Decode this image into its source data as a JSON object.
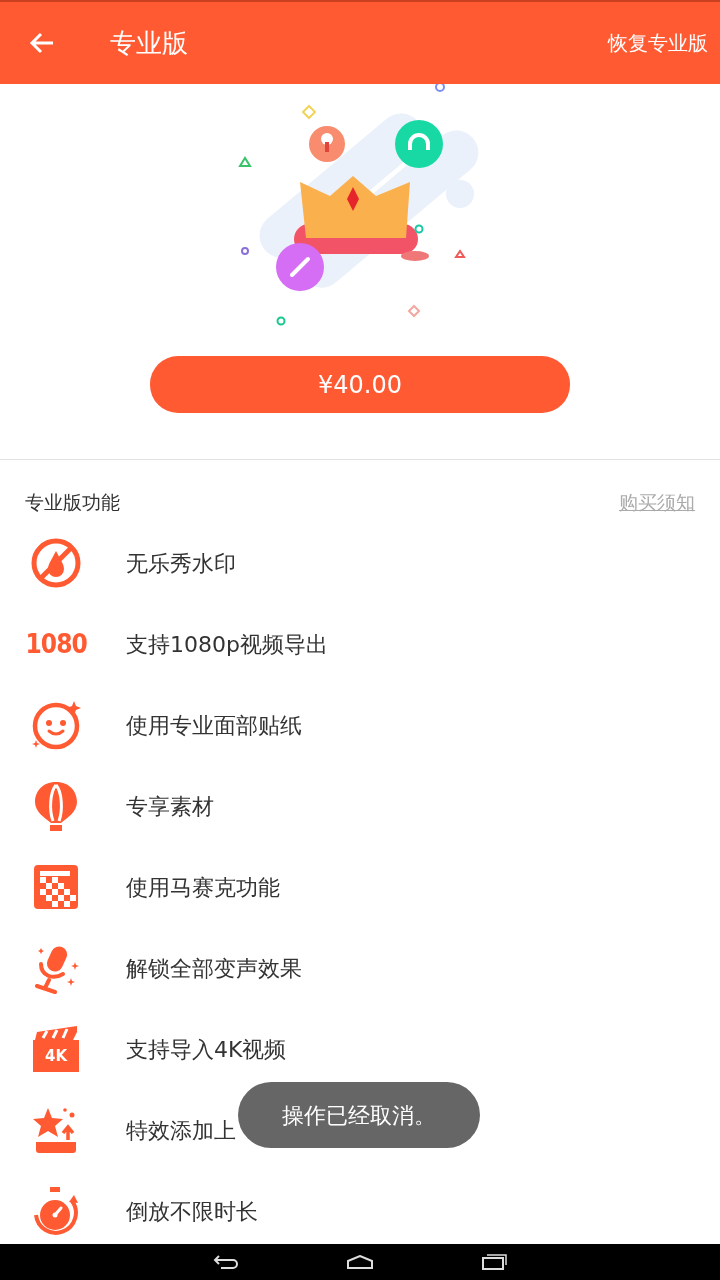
{
  "header": {
    "title": "专业版",
    "action": "恢复专业版"
  },
  "purchase": {
    "price": "¥40.00"
  },
  "features": {
    "title": "专业版功能",
    "link": "购买须知",
    "items": [
      {
        "kind": "no-watermark",
        "label": "无乐秀水印"
      },
      {
        "kind": "resolution",
        "icon_text": "1080",
        "label": "支持1080p视频导出"
      },
      {
        "kind": "face",
        "label": "使用专业面部贴纸"
      },
      {
        "kind": "balloon",
        "label": "专享素材"
      },
      {
        "kind": "mosaic",
        "label": "使用马赛克功能"
      },
      {
        "kind": "microphone",
        "label": "解锁全部变声效果"
      },
      {
        "kind": "clapper",
        "icon_text": "4K",
        "label": "支持导入4K视频"
      },
      {
        "kind": "star",
        "label": "特效添加上"
      },
      {
        "kind": "timer",
        "label": "倒放不限时长"
      }
    ]
  },
  "toast": "操作已经取消。"
}
